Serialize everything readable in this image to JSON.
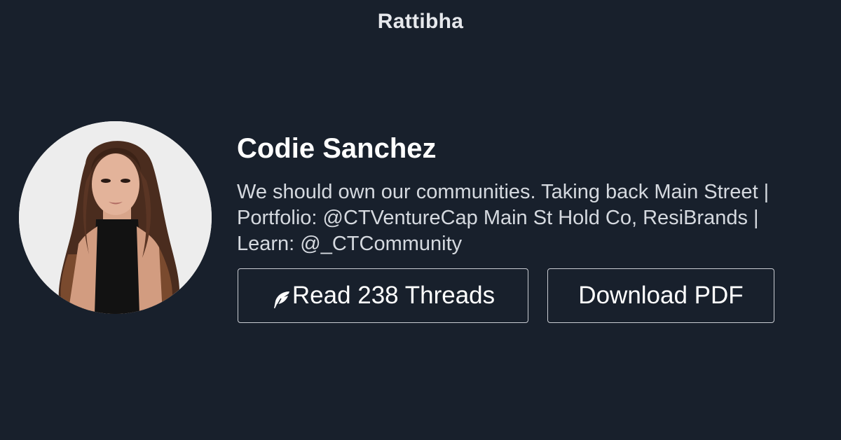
{
  "brand": {
    "name": "Rattibha"
  },
  "profile": {
    "name": "Codie Sanchez",
    "bio_line1": "We should own our communities. Taking back Main Street |",
    "bio_line2": "Portfolio: @CTVentureCap Main St Hold Co, ResiBrands |",
    "bio_line3": "Learn: @_CTCommunity",
    "avatar_alt": "Codie Sanchez"
  },
  "actions": {
    "read_label": "Read 238 Threads",
    "read_icon": "feather-icon",
    "download_label": "Download PDF"
  },
  "colors": {
    "background": "#18202c",
    "text": "#ffffff",
    "muted_text": "#d5d9df",
    "button_border": "#c9ccd2"
  }
}
